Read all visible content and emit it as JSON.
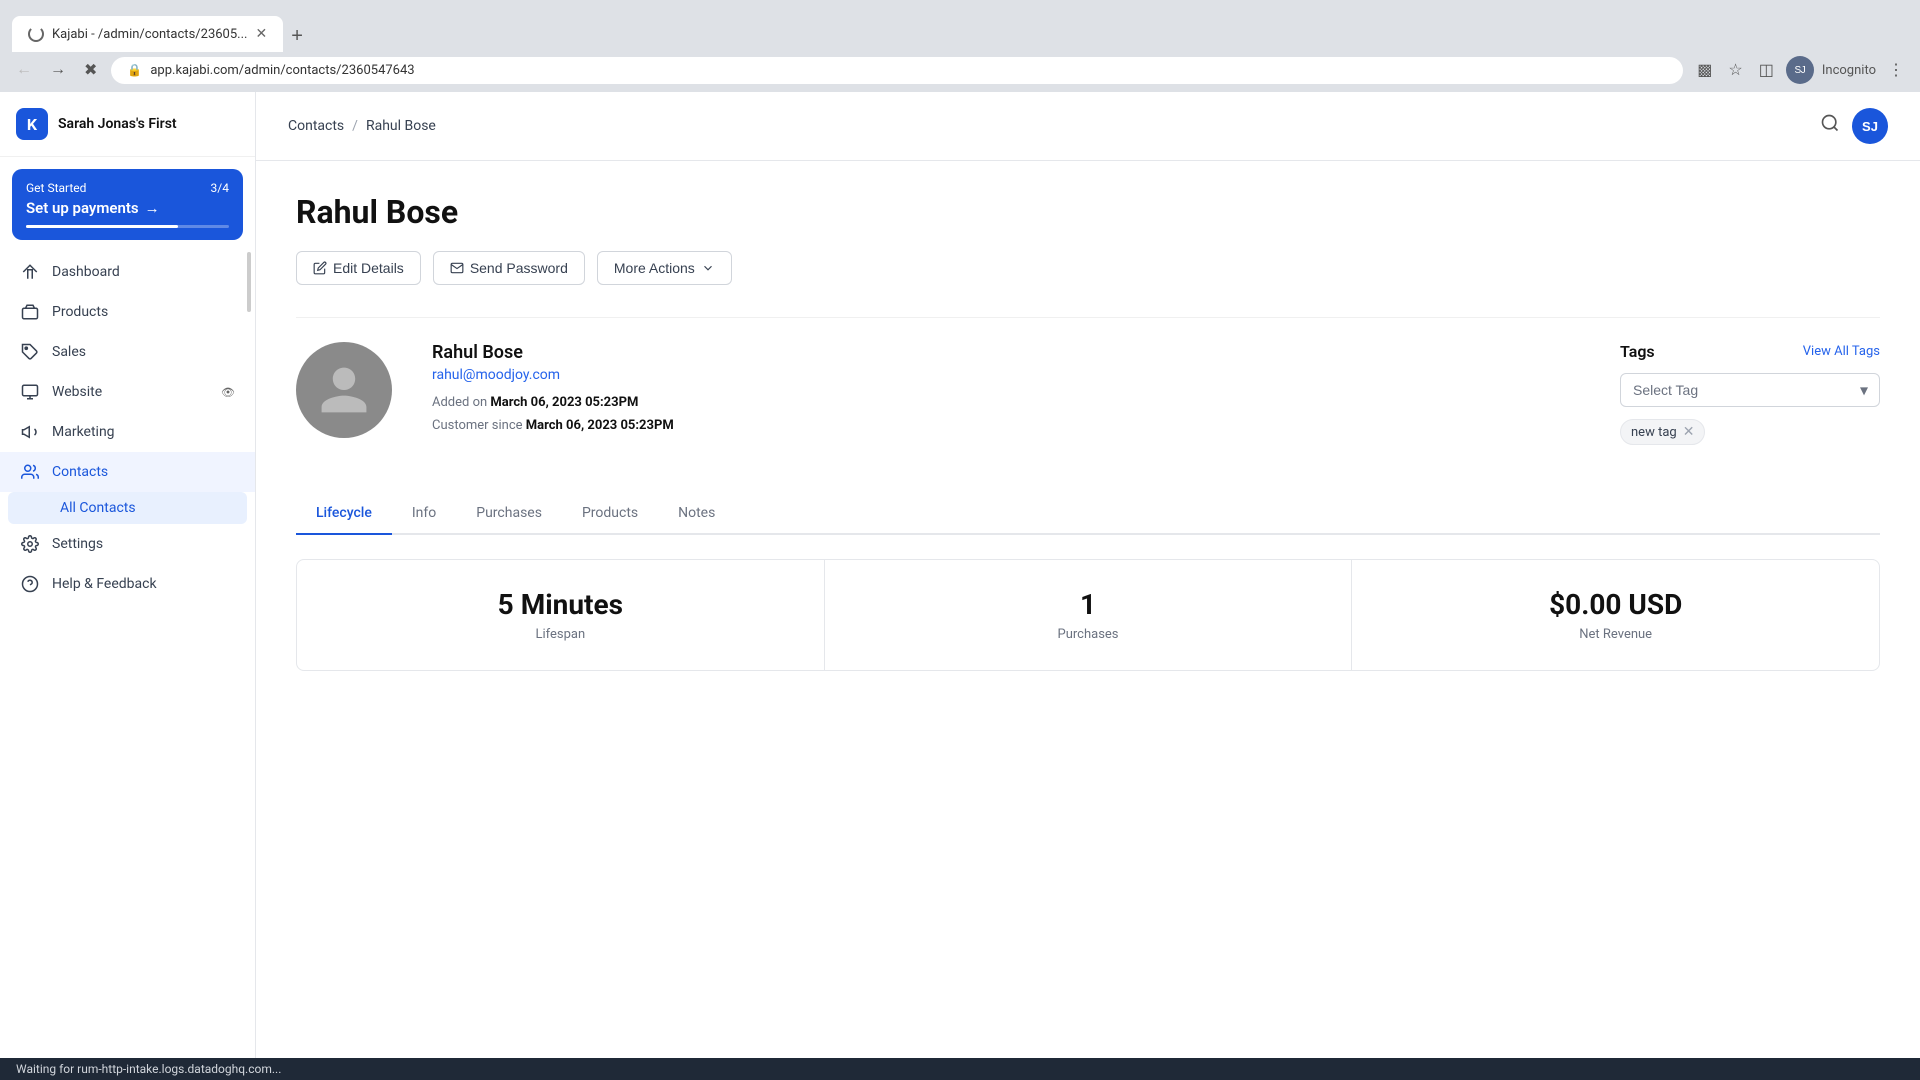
{
  "browser": {
    "tab_title": "Kajabi - /admin/contacts/23605...",
    "url": "app.kajabi.com/admin/contacts/2360547643",
    "incognito_label": "Incognito",
    "new_tab_label": "+"
  },
  "app": {
    "brand": "Sarah Jonas's First",
    "logo_letter": "K"
  },
  "sidebar": {
    "setup_banner": {
      "prefix": "Get Started",
      "progress": "3/4",
      "title": "Set up payments",
      "arrow": "→"
    },
    "nav_items": [
      {
        "id": "dashboard",
        "label": "Dashboard",
        "icon": "home"
      },
      {
        "id": "products",
        "label": "Products",
        "icon": "box"
      },
      {
        "id": "sales",
        "label": "Sales",
        "icon": "tag"
      },
      {
        "id": "website",
        "label": "Website",
        "icon": "monitor",
        "badge": "👁"
      },
      {
        "id": "marketing",
        "label": "Marketing",
        "icon": "megaphone"
      },
      {
        "id": "contacts",
        "label": "Contacts",
        "icon": "users",
        "active": true
      },
      {
        "id": "settings",
        "label": "Settings",
        "icon": "gear"
      },
      {
        "id": "help",
        "label": "Help & Feedback",
        "icon": "help"
      }
    ],
    "sub_items": [
      {
        "id": "all-contacts",
        "label": "All Contacts",
        "active": true
      }
    ]
  },
  "header": {
    "breadcrumb_home": "Contacts",
    "breadcrumb_separator": "/",
    "breadcrumb_current": "Rahul Bose",
    "search_tooltip": "Search",
    "user_initials": "SJ"
  },
  "contact": {
    "name": "Rahul Bose",
    "full_name": "Rahul Bose",
    "email": "rahul@moodjoy.com",
    "added_label": "Added on",
    "added_date": "March 06, 2023 05:23PM",
    "customer_since_label": "Customer since",
    "customer_since_date": "March 06, 2023 05:23PM"
  },
  "actions": {
    "edit_details": "Edit Details",
    "send_password": "Send Password",
    "more_actions": "More Actions"
  },
  "tags": {
    "title": "Tags",
    "view_all": "View All Tags",
    "select_placeholder": "Select Tag",
    "existing_tags": [
      {
        "id": "new-tag",
        "label": "new tag"
      }
    ]
  },
  "tabs": [
    {
      "id": "lifecycle",
      "label": "Lifecycle",
      "active": true
    },
    {
      "id": "info",
      "label": "Info"
    },
    {
      "id": "purchases",
      "label": "Purchases"
    },
    {
      "id": "products",
      "label": "Products"
    },
    {
      "id": "notes",
      "label": "Notes"
    }
  ],
  "stats": [
    {
      "id": "lifespan",
      "value": "5 Minutes",
      "label": "Lifespan"
    },
    {
      "id": "purchases",
      "value": "1",
      "label": "Purchases"
    },
    {
      "id": "net-revenue",
      "value": "$0.00 USD",
      "label": "Net Revenue"
    }
  ],
  "status_bar": {
    "message": "Waiting for rum-http-intake.logs.datadoghq.com..."
  }
}
